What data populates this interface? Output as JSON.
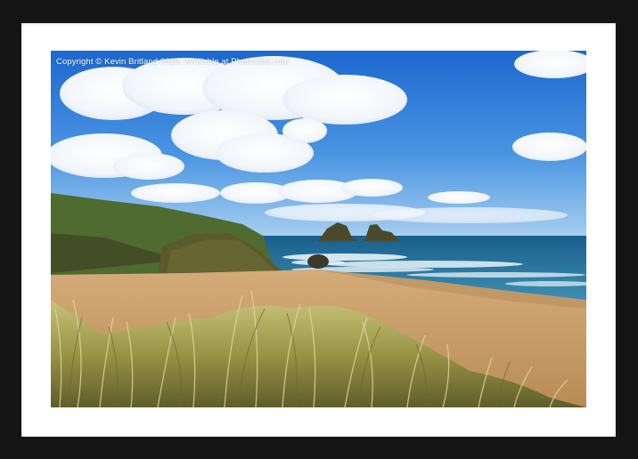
{
  "watermark": {
    "text": "Copyright © Kevin Britland  2019. Available at Photo4me.com"
  },
  "colors": {
    "frame": "#141414",
    "mount": "#ffffff",
    "sky_top": "#1f6fd1",
    "sky_bottom": "#8fc3f0",
    "sea": "#1f6f9c",
    "sand": "#c9a06a",
    "grass": "#a9a04e"
  },
  "scene": {
    "subjects": [
      "sky-with-clouds",
      "sea-with-waves",
      "rock-islets",
      "grassy-headland",
      "sandy-beach",
      "dune-grass"
    ]
  }
}
